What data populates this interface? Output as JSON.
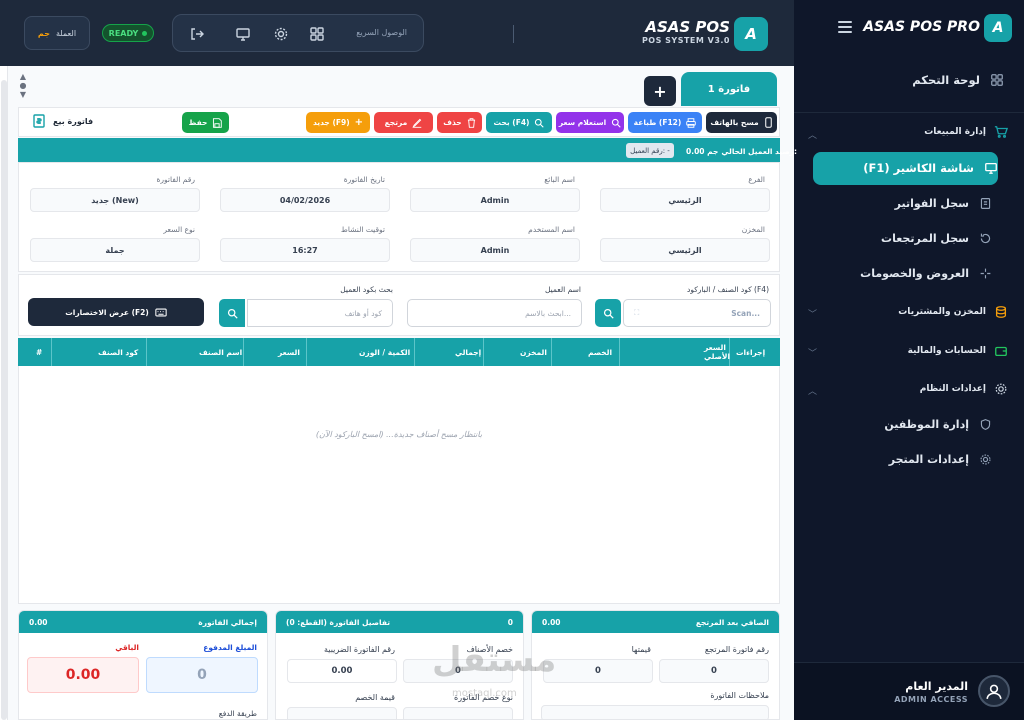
{
  "header": {
    "brand": "ASAS POS",
    "subtitle": "POS SYSTEM V3.0",
    "logo_letter": "A",
    "quick_access": "الوصول السريع",
    "status": "READY",
    "currency_label": "العملة",
    "currency_symbol": "جم"
  },
  "sidebar": {
    "brand": "ASAS POS PRO",
    "logo_letter": "A",
    "dashboard": "لوحة التحكم",
    "sales_section": "إدارة المبيعات",
    "sales_items": [
      "شاشة الكاشير (F1)",
      "سجل الفواتير",
      "سجل المرتجعات",
      "العروض والخصومات"
    ],
    "inventory_section": "المخزن والمشتريات",
    "accounts_section": "الحسابات والمالية",
    "settings_section": "إعدادات النظام",
    "settings_items": [
      "إدارة الموظفين",
      "إعدادات المتجر"
    ],
    "user_name": "المدير العام",
    "user_role": "ADMIN ACCESS"
  },
  "tabs": {
    "invoice_tab": "فاتورة 1",
    "add_tab": "+"
  },
  "toolbar": {
    "scan_phone": "مسح بالهاتف",
    "print": "طباعة (F12)",
    "price_inquiry": "استعلام سعر",
    "search": "بحث (F4)",
    "delete": "حذف",
    "return": "مرتجع",
    "new": "جديد (F9)",
    "save": "حفظ",
    "sale_invoice": "فاتورة بيع"
  },
  "balance": {
    "label": "رصيد العميل الحالي:",
    "value": "0.00 جم",
    "customer_number": "رقم العميل: -"
  },
  "info": {
    "branch_label": "الفرع",
    "branch_value": "الرئيسي",
    "seller_label": "اسم البائع",
    "seller_value": "Admin",
    "date_label": "تاريخ الفاتورة",
    "date_value": "04/02/2026",
    "invoice_no_label": "رقم الفاتورة",
    "invoice_no_value": "جديد (New)",
    "warehouse_label": "المخزن",
    "warehouse_value": "الرئيسي",
    "user_label": "اسم المستخدم",
    "user_value": "Admin",
    "activity_label": "توقيت النشاط",
    "activity_value": "16:27",
    "price_type_label": "نوع السعر",
    "price_type_value": "جملة"
  },
  "search": {
    "barcode_label": "كود الصنف / الباركود (F4)",
    "barcode_placeholder": "Scan...",
    "customer_name_label": "اسم العميل",
    "customer_name_placeholder": "ابحث بالاسم...",
    "customer_code_label": "بحث بكود العميل",
    "customer_code_placeholder": "كود أو هاتف",
    "shortcuts": "عرض الاختصارات (F2)"
  },
  "table": {
    "headers": [
      "إجراءات",
      "السعر الأصلي",
      "الخصم",
      "المخزن",
      "إجمالي",
      "الكمية / الوزن",
      "السعر",
      "اسم الصنف",
      "كود الصنف",
      "#"
    ],
    "empty": "بانتظار مسح أصناف جديدة... (امسح الباركود الآن)"
  },
  "summary": {
    "net_title": "الصافي بعد المرتجع",
    "net_value": "0.00",
    "return_inv_label": "رقم فاتورة المرتجع",
    "return_inv_value": "0",
    "return_value_label": "قيمتها",
    "return_value_value": "0",
    "notes_label": "ملاحظات الفاتورة",
    "details_title": "تفاصيل الفاتورة (القطع: 0)",
    "details_count": "0",
    "items_discount_label": "خصم الأصناف",
    "items_discount_value": "0",
    "tax_inv_label": "رقم الفاتورة الضريبية",
    "tax_inv_value": "0.00",
    "inv_discount_type_label": "نوع خصم الفاتورة",
    "discount_value_label": "قيمة الخصم",
    "total_title": "إجمالي الفاتورة",
    "total_value": "0.00",
    "paid_label": "المبلغ المدفوع",
    "paid_value": "0",
    "remaining_label": "الباقي",
    "remaining_value": "0.00",
    "payment_method_label": "طريقة الدفع"
  },
  "watermark": {
    "text": "مستقل",
    "url": "mostaql.com"
  },
  "colors": {
    "teal": "#17a2a8",
    "navy": "#1e293b",
    "sidebar": "#0f172a",
    "green": "#16a34a",
    "red": "#ef4444",
    "orange": "#f59e0b",
    "purple": "#9333ea",
    "blue": "#3b82f6"
  }
}
